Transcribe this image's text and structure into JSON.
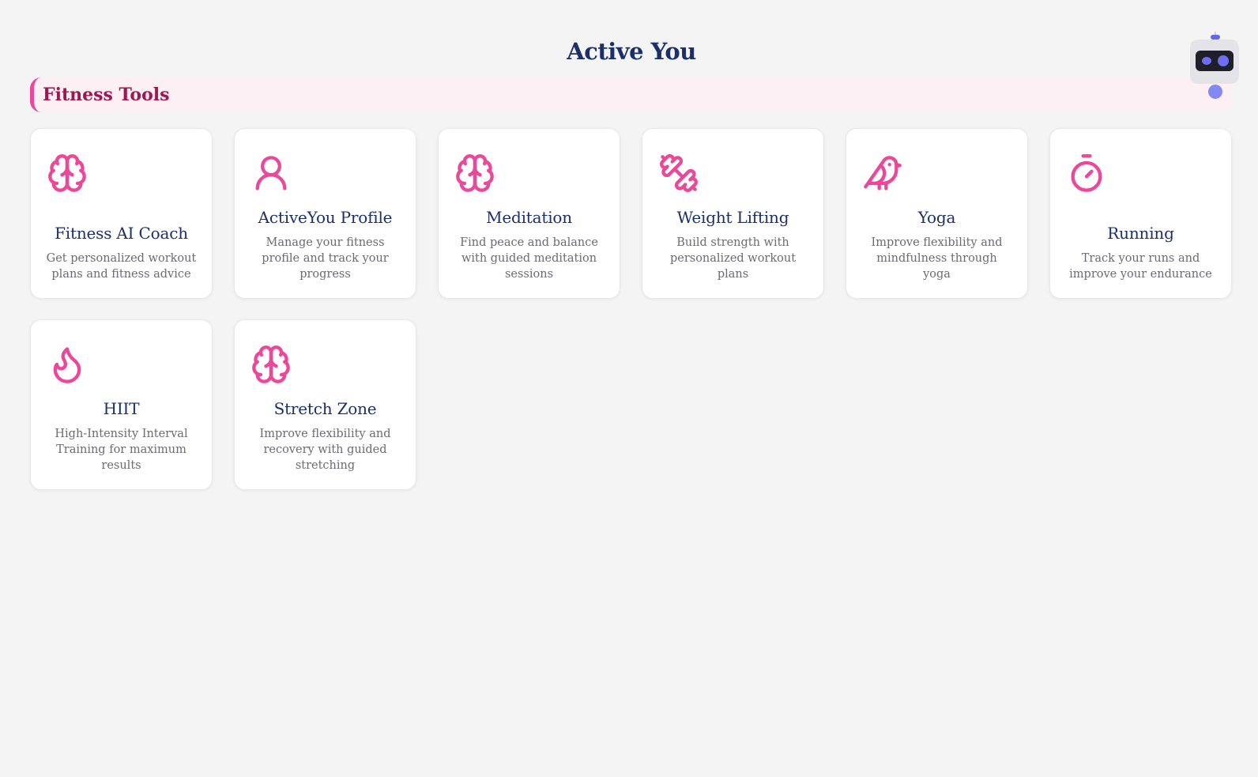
{
  "app": {
    "title": "Active You"
  },
  "section": {
    "title": "Fitness Tools"
  },
  "colors": {
    "accent": "#ec4899",
    "title": "#1b2f6b",
    "section_title": "#a0174f",
    "section_bg": "#fdf0f5",
    "assistant": "#6366f1"
  },
  "assistant": {
    "icon": "robot-icon"
  },
  "cards": [
    {
      "icon": "brain-icon",
      "title": "Fitness AI Coach",
      "description": "Get personalized workout plans and fitness advice"
    },
    {
      "icon": "user-icon",
      "title": "ActiveYou Profile",
      "description": "Manage your fitness profile and track your progress"
    },
    {
      "icon": "brain-icon",
      "title": "Meditation",
      "description": "Find peace and balance with guided meditation sessions"
    },
    {
      "icon": "dumbbell-icon",
      "title": "Weight Lifting",
      "description": "Build strength with personalized workout plans"
    },
    {
      "icon": "bird-icon",
      "title": "Yoga",
      "description": "Improve flexibility and mindfulness through yoga"
    },
    {
      "icon": "timer-icon",
      "title": "Running",
      "description": "Track your runs and improve your endurance"
    },
    {
      "icon": "flame-icon",
      "title": "HIIT",
      "description": "High-Intensity Interval Training for maximum results"
    },
    {
      "icon": "brain-icon",
      "title": "Stretch Zone",
      "description": "Improve flexibility and recovery with guided stretching"
    }
  ]
}
